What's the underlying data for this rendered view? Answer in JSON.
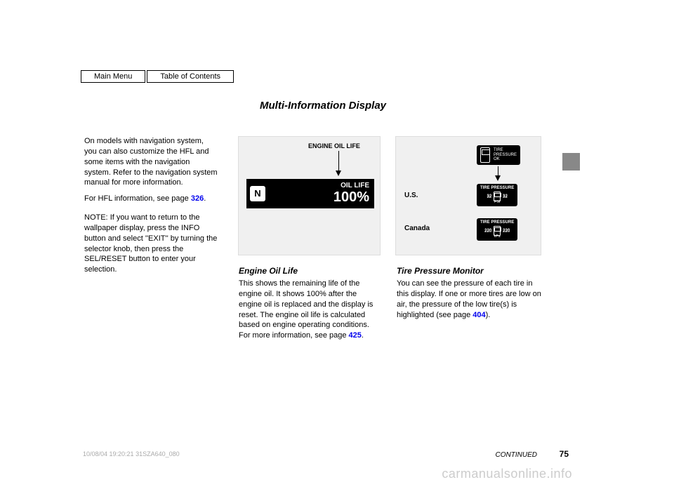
{
  "nav": {
    "main_menu": "Main Menu",
    "toc": "Table of Contents"
  },
  "title": "Multi-Information Display",
  "left": {
    "para1": "On models with navigation system, you can also customize the HFL and some items with the navigation system. Refer to the navigation system manual for more information.",
    "para2_pre": "For HFL information, see page ",
    "para2_link": "326",
    "para2_post": ".",
    "note_head": "NOTE:",
    "note_body": "If you want to return to the wallpaper display, press the INFO button and select ''EXIT'' by turning the selector knob, then press the SEL/RESET button to enter your selection."
  },
  "center": {
    "head": "Engine Oil Life",
    "body_pre": "This shows the remaining life of the engine oil. It shows 100% after the engine oil is replaced and the display is reset. The engine oil life is calculated based on engine operating conditions. For more information, see page ",
    "body_link": "425",
    "body_post": ".",
    "display": {
      "label": "ENGINE OIL LIFE",
      "gear": "N",
      "oil_label": "OIL LIFE",
      "pct": "100%"
    }
  },
  "right": {
    "head": "Tire Pressure Monitor",
    "body_pre": "You can see the pressure of each tire in this display. If one or more tires are low on air, the pressure of the low tire(s) is highlighted (see page ",
    "body_link": "404",
    "body_post": ").",
    "display": {
      "us": "U.S.",
      "ca": "Canada",
      "ok_label": "TIRE PRESSURE OK",
      "tp_header": "TIRE PRESSURE",
      "us_vals": {
        "fl": "32",
        "fr": "32",
        "rl": "32",
        "rr": "32",
        "unit": "PSI"
      },
      "ca_vals": {
        "fl": "220",
        "fr": "220",
        "rl": "220",
        "rr": "220",
        "unit": "kPa"
      }
    }
  },
  "continued": "CONTINUED",
  "footer": "10/08/04 19:20:21 31SZA640_080",
  "pageno": "75",
  "watermark": "carmanualsonline.info"
}
